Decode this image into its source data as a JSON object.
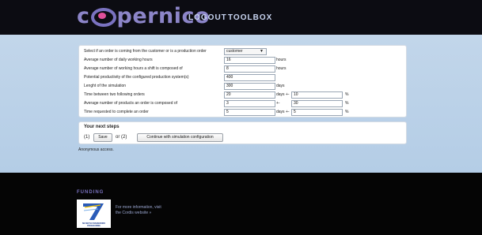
{
  "header": {
    "logo_text_pre": "c",
    "logo_text_post": "pernico",
    "nav": {
      "logout": "LOGOUT",
      "toolbox": "TOOLBOX"
    }
  },
  "form": {
    "order_source": {
      "label": "Select if an order is coming from the customer or is a production order",
      "selected": "customer"
    },
    "rows": [
      {
        "label": "Average number of daily working hours",
        "value": "16",
        "unit": "hours"
      },
      {
        "label": "Average number of working hours a shift is composed of",
        "value": "8",
        "unit": "hours"
      },
      {
        "label": "Potential productivity of the configured production system(s)",
        "value": "400",
        "unit": ""
      },
      {
        "label": "Lenght of the simulation",
        "value": "300",
        "unit": "days"
      },
      {
        "label": "Time between two following orders",
        "value": "20",
        "unit": "days +-",
        "value2": "10",
        "unit2": "%"
      },
      {
        "label": "Average number of products an order is composed of",
        "value": "3",
        "unit": "+-",
        "value2": "30",
        "unit2": "%"
      },
      {
        "label": "Time requested to complete an order",
        "value": "5",
        "unit": "days +-",
        "value2": "5",
        "unit2": "%"
      }
    ]
  },
  "next_steps": {
    "title": "Your next steps",
    "step1": "(1)",
    "save_label": "Save",
    "or2": "or (2)",
    "continue_label": "Continue with simulation configuration"
  },
  "status": {
    "anonymous": "Anonymous access."
  },
  "footer": {
    "funding_label": "FUNDING",
    "fp7_text_line1": "SEVENTH FRAMEWORK",
    "fp7_text_line2": "PROGRAMME",
    "note_line1": "For more information, visit",
    "note_line2": "the Cordis website »"
  }
}
